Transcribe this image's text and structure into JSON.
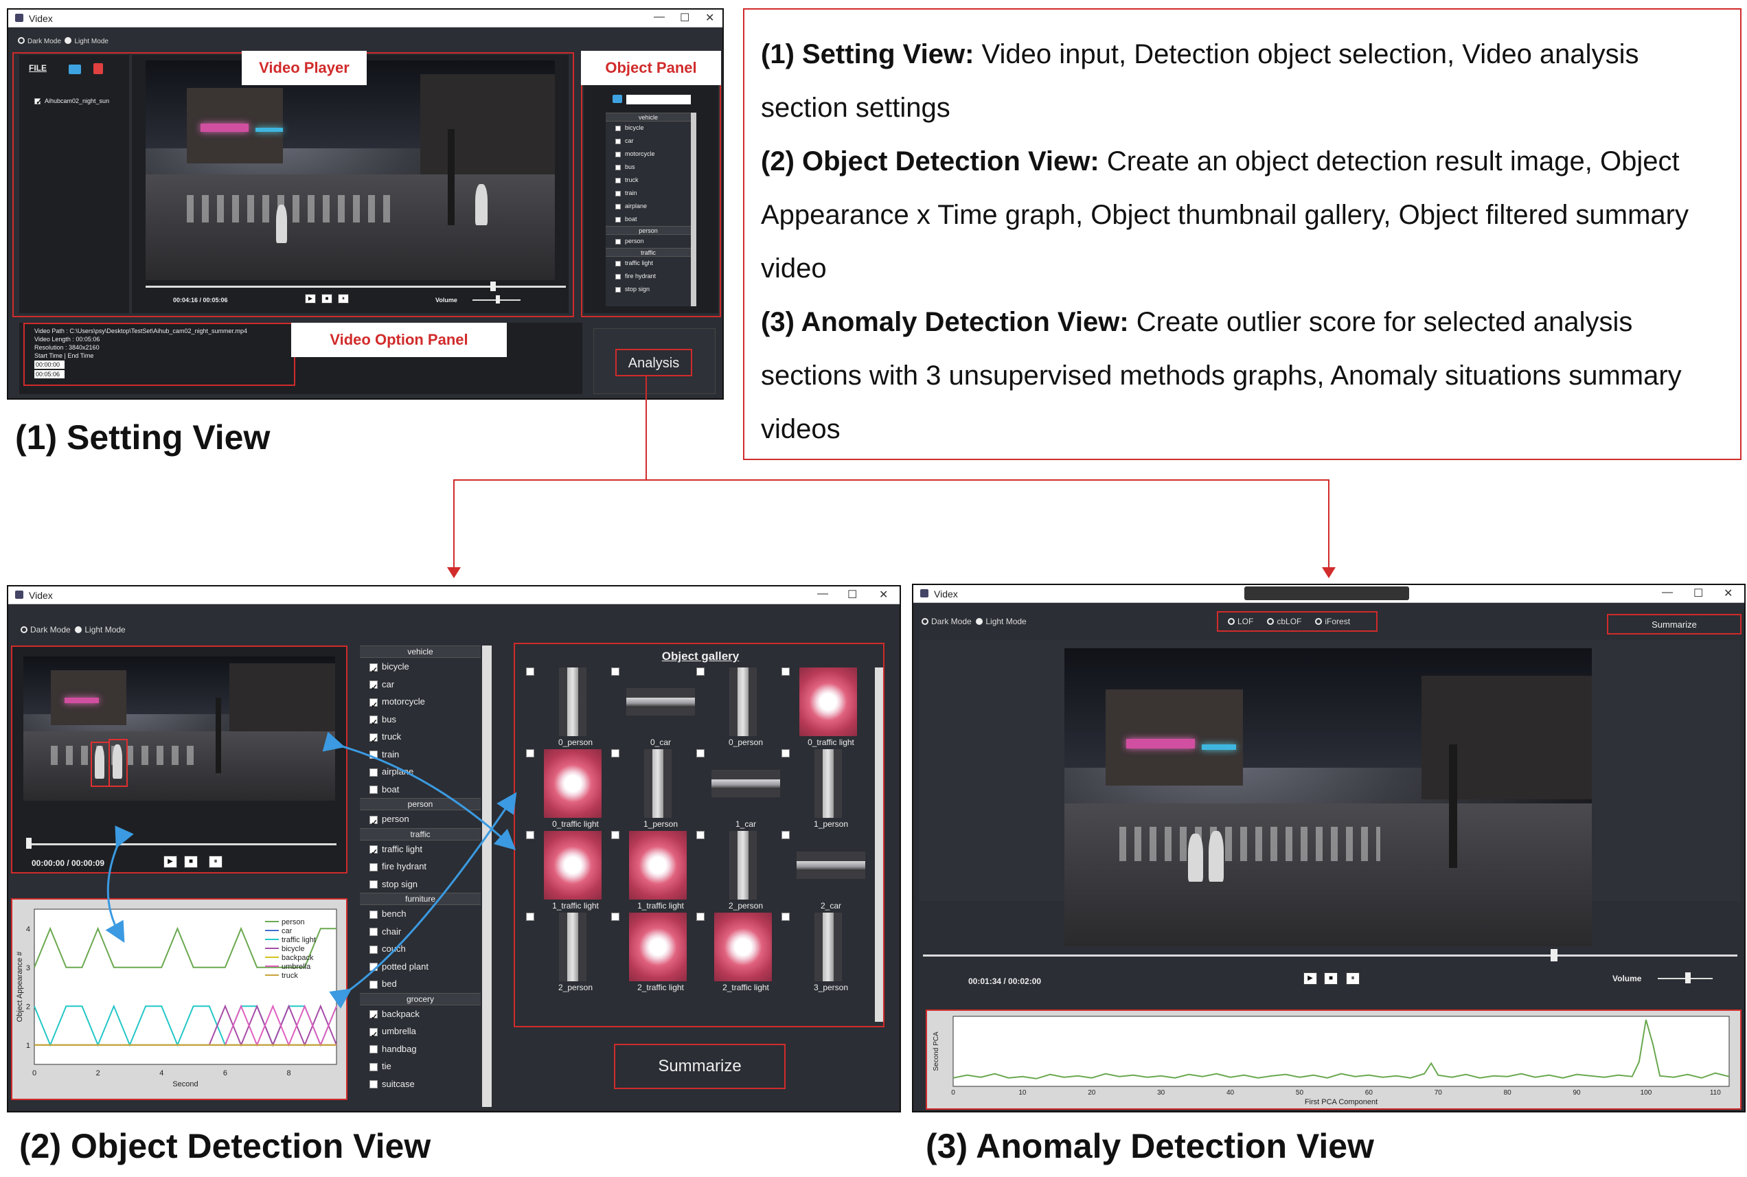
{
  "description": {
    "items": [
      {
        "heading": "(1) Setting View:",
        "text": " Video input, Detection object selection, Video analysis section settings"
      },
      {
        "heading": "(2) Object Detection View:",
        "text": " Create an object detection result image, Object Appearance x Time graph, Object thumbnail gallery, Object filtered summary video"
      },
      {
        "heading": "(3) Anomaly Detection View:",
        "text": " Create outlier score for selected analysis sections with 3 unsupervised methods graphs, Anomaly situations summary videos"
      }
    ]
  },
  "captions": {
    "setting": "(1) Setting View",
    "object": "(2) Object Detection View",
    "anomaly": "(3) Anomaly Detection View"
  },
  "app": {
    "title": "Videx",
    "dark_mode": "Dark Mode",
    "light_mode": "Light Mode"
  },
  "setting_view": {
    "file_label": "FILE",
    "file_item": "Aihubcam02_night_sun",
    "labels": {
      "video_player": "Video Player",
      "object_panel": "Object Panel",
      "video_option_panel": "Video Option  Panel"
    },
    "time": "00:04:16 / 00:05:06",
    "volume": "Volume",
    "object_list": [
      {
        "type": "header",
        "label": "vehicle"
      },
      {
        "type": "item",
        "label": "bicycle"
      },
      {
        "type": "item",
        "label": "car"
      },
      {
        "type": "item",
        "label": "motorcycle"
      },
      {
        "type": "item",
        "label": "bus"
      },
      {
        "type": "item",
        "label": "truck"
      },
      {
        "type": "item",
        "label": "train"
      },
      {
        "type": "item",
        "label": "airplane"
      },
      {
        "type": "item",
        "label": "boat"
      },
      {
        "type": "header",
        "label": "person"
      },
      {
        "type": "item",
        "label": "person"
      },
      {
        "type": "header",
        "label": "traffic"
      },
      {
        "type": "item",
        "label": "traffic light"
      },
      {
        "type": "item",
        "label": "fire hydrant"
      },
      {
        "type": "item",
        "label": "stop sign"
      }
    ],
    "video_info": {
      "path": "Video Path : C:\\Users\\psy\\Desktop\\TestSet\\Aihub_cam02_night_summer.mp4",
      "length": "Video Length : 00:05:06",
      "resolution": "Resolution : 3840x2160",
      "start_end": "Start Time | End Time",
      "start": "00:00:00",
      "end": "00:05:06"
    },
    "analysis_button": "Analysis"
  },
  "object_view": {
    "time": "00:00:00 / 00:00:09",
    "categories": [
      {
        "type": "header",
        "label": "vehicle"
      },
      {
        "type": "item",
        "label": "bicycle",
        "checked": true
      },
      {
        "type": "item",
        "label": "car",
        "checked": true
      },
      {
        "type": "item",
        "label": "motorcycle",
        "checked": true
      },
      {
        "type": "item",
        "label": "bus",
        "checked": true
      },
      {
        "type": "item",
        "label": "truck",
        "checked": true
      },
      {
        "type": "item",
        "label": "train",
        "checked": false
      },
      {
        "type": "item",
        "label": "airplane",
        "checked": false
      },
      {
        "type": "item",
        "label": "boat",
        "checked": false
      },
      {
        "type": "header",
        "label": "person"
      },
      {
        "type": "item",
        "label": "person",
        "checked": true
      },
      {
        "type": "header",
        "label": "traffic"
      },
      {
        "type": "item",
        "label": "traffic light",
        "checked": true
      },
      {
        "type": "item",
        "label": "fire hydrant",
        "checked": false
      },
      {
        "type": "item",
        "label": "stop sign",
        "checked": false
      },
      {
        "type": "header",
        "label": "furniture"
      },
      {
        "type": "item",
        "label": "bench",
        "checked": false
      },
      {
        "type": "item",
        "label": "chair",
        "checked": false
      },
      {
        "type": "item",
        "label": "couch",
        "checked": false
      },
      {
        "type": "item",
        "label": "potted plant",
        "checked": false
      },
      {
        "type": "item",
        "label": "bed",
        "checked": false
      },
      {
        "type": "header",
        "label": "grocery"
      },
      {
        "type": "item",
        "label": "backpack",
        "checked": true
      },
      {
        "type": "item",
        "label": "umbrella",
        "checked": true
      },
      {
        "type": "item",
        "label": "handbag",
        "checked": false
      },
      {
        "type": "item",
        "label": "tie",
        "checked": false
      },
      {
        "type": "item",
        "label": "suitcase",
        "checked": false
      }
    ],
    "gallery_title": "Object gallery",
    "gallery": [
      {
        "label": "0_person",
        "kind": "person"
      },
      {
        "label": "0_car",
        "kind": "car"
      },
      {
        "label": "0_person",
        "kind": "person"
      },
      {
        "label": "0_traffic light",
        "kind": "light"
      },
      {
        "label": "0_traffic light",
        "kind": "light"
      },
      {
        "label": "1_person",
        "kind": "person"
      },
      {
        "label": "1_car",
        "kind": "car"
      },
      {
        "label": "1_person",
        "kind": "person"
      },
      {
        "label": "1_traffic light",
        "kind": "light"
      },
      {
        "label": "1_traffic light",
        "kind": "light"
      },
      {
        "label": "2_person",
        "kind": "person"
      },
      {
        "label": "2_car",
        "kind": "car"
      },
      {
        "label": "2_person",
        "kind": "person"
      },
      {
        "label": "2_traffic light",
        "kind": "light"
      },
      {
        "label": "2_traffic light",
        "kind": "light"
      },
      {
        "label": "3_person",
        "kind": "person"
      }
    ],
    "summarize_button": "Summarize",
    "chart": {
      "ylabel": "Object Appearance #",
      "xlabel": "Second",
      "xticks": [
        "0",
        "2",
        "4",
        "6",
        "8"
      ],
      "yticks": [
        "1",
        "2",
        "3",
        "4"
      ],
      "legend": [
        {
          "name": "person",
          "color": "#6aa84f"
        },
        {
          "name": "car",
          "color": "#3d6fcf"
        },
        {
          "name": "traffic light",
          "color": "#24c6c6"
        },
        {
          "name": "bicycle",
          "color": "#a64ca6"
        },
        {
          "name": "backpack",
          "color": "#d4c21a"
        },
        {
          "name": "umbrella",
          "color": "#e05fbf"
        },
        {
          "name": "truck",
          "color": "#c9a43a"
        }
      ]
    }
  },
  "anomaly_view": {
    "methods": [
      "LOF",
      "cbLOF",
      "iForest"
    ],
    "summarize_button": "Summarize",
    "time": "00:01:34 / 00:02:00",
    "volume": "Volume",
    "chart": {
      "ylabel": "Second PCA",
      "xlabel": "First PCA Component",
      "xticks": [
        "0",
        "10",
        "20",
        "30",
        "40",
        "50",
        "60",
        "70",
        "80",
        "90",
        "100",
        "110"
      ]
    }
  },
  "chart_data": [
    {
      "type": "line",
      "ylabel": "Object Appearance #",
      "xlabel": "Second",
      "xlim": [
        0,
        9.5
      ],
      "ylim": [
        0.5,
        4.5
      ],
      "series": [
        {
          "name": "person",
          "x": [
            0,
            0.5,
            1,
            1.5,
            2,
            2.5,
            3,
            3.5,
            4,
            4.5,
            5,
            5.5,
            6,
            6.5,
            7,
            7.5,
            8,
            8.5,
            9,
            9.5
          ],
          "values": [
            3,
            4,
            3,
            3,
            4,
            3,
            3,
            3,
            3,
            4,
            3,
            3,
            3,
            4,
            3,
            3,
            3,
            3,
            4,
            4
          ]
        },
        {
          "name": "car",
          "x": [
            0,
            9.5
          ],
          "values": [
            1,
            1
          ]
        },
        {
          "name": "traffic light",
          "x": [
            0,
            0.5,
            1,
            1.5,
            2,
            2.5,
            3,
            3.5,
            4,
            4.5,
            5,
            5.5,
            6,
            6.5,
            7,
            7.5,
            8,
            8.5,
            9,
            9.5
          ],
          "values": [
            2,
            1,
            2,
            2,
            1,
            2,
            1,
            2,
            2,
            1,
            2,
            2,
            1,
            2,
            2,
            1,
            2,
            2,
            1,
            2
          ]
        },
        {
          "name": "bicycle",
          "x": [
            5.5,
            6,
            6.5,
            7,
            7.5,
            8,
            8.5,
            9,
            9.5
          ],
          "values": [
            1,
            2,
            1,
            2,
            1,
            2,
            1,
            2,
            1
          ]
        },
        {
          "name": "backpack",
          "x": [
            0,
            9.5
          ],
          "values": [
            1,
            1
          ]
        },
        {
          "name": "umbrella",
          "x": [
            6,
            6.5,
            7,
            7.5,
            8,
            8.5,
            9,
            9.5
          ],
          "values": [
            1,
            2,
            1,
            2,
            1,
            2,
            1,
            2
          ]
        },
        {
          "name": "truck",
          "x": [
            0,
            9.5
          ],
          "values": [
            1,
            1
          ]
        }
      ]
    },
    {
      "type": "line",
      "ylabel": "Second PCA",
      "xlabel": "First PCA Component",
      "xlim": [
        0,
        112
      ],
      "ylim": [
        0,
        1
      ],
      "series": [
        {
          "name": "",
          "x": [
            0,
            2,
            4,
            6,
            8,
            10,
            12,
            14,
            16,
            18,
            20,
            22,
            24,
            26,
            28,
            30,
            32,
            34,
            36,
            38,
            40,
            42,
            44,
            46,
            48,
            50,
            52,
            54,
            56,
            58,
            60,
            62,
            64,
            66,
            68,
            69,
            70,
            72,
            74,
            76,
            78,
            80,
            82,
            84,
            86,
            88,
            90,
            92,
            94,
            96,
            98,
            99,
            100,
            101,
            102,
            104,
            106,
            108,
            110,
            112
          ],
          "values": [
            0.12,
            0.16,
            0.13,
            0.18,
            0.12,
            0.14,
            0.11,
            0.17,
            0.13,
            0.15,
            0.12,
            0.18,
            0.14,
            0.16,
            0.13,
            0.15,
            0.12,
            0.17,
            0.14,
            0.18,
            0.13,
            0.16,
            0.12,
            0.15,
            0.17,
            0.13,
            0.16,
            0.12,
            0.18,
            0.14,
            0.16,
            0.13,
            0.15,
            0.12,
            0.18,
            0.33,
            0.16,
            0.13,
            0.17,
            0.12,
            0.15,
            0.14,
            0.18,
            0.13,
            0.16,
            0.12,
            0.17,
            0.15,
            0.13,
            0.16,
            0.14,
            0.35,
            0.95,
            0.6,
            0.15,
            0.13,
            0.17,
            0.12,
            0.19,
            0.14
          ]
        }
      ]
    }
  ]
}
